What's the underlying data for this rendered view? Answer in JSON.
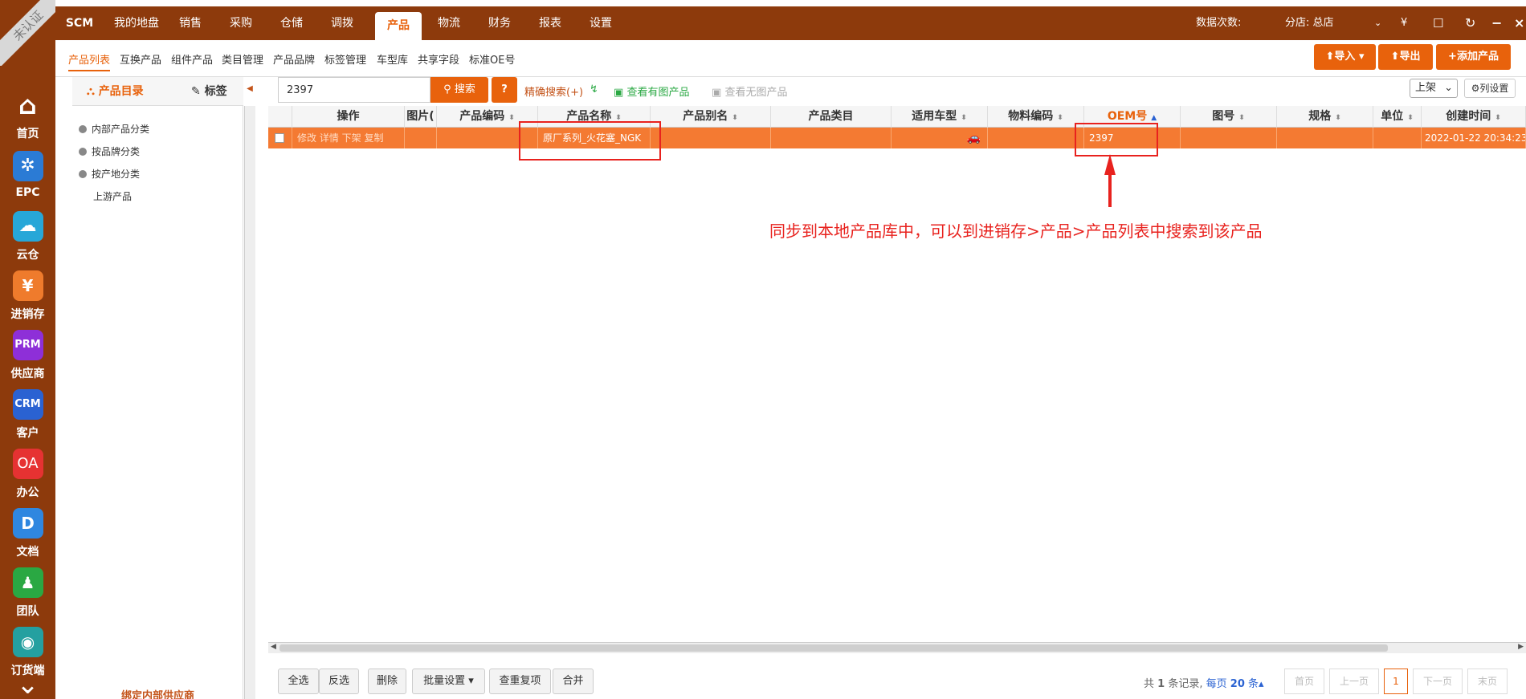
{
  "badge": "未认证",
  "sidebar": {
    "items": [
      {
        "label": "首页",
        "icon": "home-icon",
        "glyph": "⌂",
        "color": "#8d3a0c"
      },
      {
        "label": "EPC",
        "icon": "network-icon",
        "glyph": "✲",
        "color": "#2b7bd5"
      },
      {
        "label": "云仓",
        "icon": "cloud-icon",
        "glyph": "☁",
        "color": "#27a7d8"
      },
      {
        "label": "进销存",
        "icon": "yen-icon",
        "glyph": "¥",
        "color": "#ef7b2c"
      },
      {
        "label": "供应商",
        "icon": "prm-icon",
        "glyph": "PRM",
        "color": "#8e2fd8"
      },
      {
        "label": "客户",
        "icon": "crm-icon",
        "glyph": "CRM",
        "color": "#2a62d2"
      },
      {
        "label": "办公",
        "icon": "oa-icon",
        "glyph": "OA",
        "color": "#e63232"
      },
      {
        "label": "文档",
        "icon": "document-icon",
        "glyph": "D",
        "color": "#2f87e0"
      },
      {
        "label": "团队",
        "icon": "team-icon",
        "glyph": "♟",
        "color": "#2aa843"
      },
      {
        "label": "订货端",
        "icon": "order-icon",
        "glyph": "◉",
        "color": "#24a0a0"
      }
    ],
    "more_glyph": "⌄"
  },
  "topnav": {
    "items": [
      "SCM",
      "我的地盘",
      "销售",
      "采购",
      "仓储",
      "调拨",
      "产品",
      "物流",
      "财务",
      "报表",
      "设置"
    ],
    "active": "产品",
    "data_count_label": "数据次数:",
    "branch_label": "分店: 总店",
    "currency": "¥"
  },
  "subnav": {
    "items": [
      "产品列表",
      "互换产品",
      "组件产品",
      "类目管理",
      "产品品牌",
      "标签管理",
      "车型库",
      "共享字段",
      "标准OE号"
    ],
    "active": "产品列表",
    "import_label": "导入",
    "export_label": "导出",
    "add_label": "添加产品"
  },
  "tree": {
    "tabs": [
      "产品目录",
      "标签"
    ],
    "nodes": [
      "内部产品分类",
      "按品牌分类",
      "按产地分类",
      "上游产品"
    ],
    "bottom_link": "绑定内部供应商"
  },
  "search": {
    "value": "2397",
    "button": "搜索",
    "help": "?",
    "precise": "精确搜索(+)",
    "with_image": "查看有图产品",
    "without_image": "查看无图产品",
    "status_select": "上架",
    "column_settings": "列设置"
  },
  "table": {
    "columns": [
      "操作",
      "图片(",
      "产品编码",
      "产品名称",
      "产品别名",
      "产品类目",
      "适用车型",
      "物料编码",
      "OEM号",
      "图号",
      "规格",
      "单位",
      "创建时间"
    ],
    "rows": [
      {
        "actions": "修改 详情 下架 复制",
        "image": "",
        "code": "",
        "name": "原厂系列_火花塞_NGK",
        "alias": "",
        "category": "",
        "vehicle_icon": "car-icon",
        "material_code": "",
        "oem": "2397",
        "drawing_no": "",
        "spec": "",
        "unit": "",
        "created": "2022-01-22 20:34:23"
      }
    ]
  },
  "annotation": "同步到本地产品库中，可以到进销存>产品>产品列表中搜索到该产品",
  "footer": {
    "buttons": [
      "全选",
      "反选",
      "删除",
      "批量设置",
      "查重复项",
      "合并"
    ],
    "summary_prefix": "共",
    "summary_count": "1",
    "summary_suffix": "条记录,",
    "page_size_prefix": "每页",
    "page_size": "20",
    "page_size_suffix": "条",
    "pager": [
      "首页",
      "上一页",
      "1",
      "下一页",
      "末页"
    ]
  },
  "colors": {
    "brand": "#8d3a0c",
    "accent": "#e8620c",
    "selected_row": "#f47a32",
    "annotation": "#e8221e"
  }
}
